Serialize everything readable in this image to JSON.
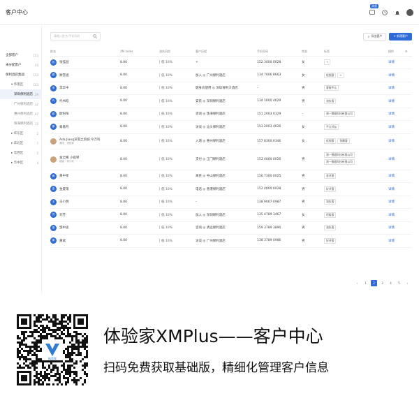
{
  "header": {
    "title": "客户中心",
    "badge": "消息"
  },
  "sidebar": {
    "items": [
      {
        "label": "全部客户",
        "count": "153",
        "level": "top"
      },
      {
        "label": "未分配客户",
        "count": "20",
        "level": "top"
      },
      {
        "label": "保利酒店集团",
        "count": "133",
        "level": "top"
      },
      {
        "label": "华南区",
        "count": "123",
        "level": "child",
        "caret": "▾"
      },
      {
        "label": "深圳保利酒店",
        "count": "29",
        "level": "sub",
        "active": true
      },
      {
        "label": "广州保利酒店",
        "count": "32",
        "level": "sub"
      },
      {
        "label": "惠州保利酒店",
        "count": "47",
        "level": "sub"
      },
      {
        "label": "珠海保利酒店",
        "count": "15",
        "level": "sub"
      },
      {
        "label": "华东区",
        "count": "2",
        "level": "child",
        "caret": "▸"
      },
      {
        "label": "华北区",
        "count": "7",
        "level": "child",
        "caret": "▸"
      },
      {
        "label": "华西区",
        "count": "2",
        "level": "child",
        "caret": "▸"
      },
      {
        "label": "华中区",
        "count": "4",
        "level": "child",
        "caret": "▸"
      }
    ]
  },
  "toolbar": {
    "search_placeholder": "请输入姓名/手机号码",
    "export_label": "导出客户",
    "new_label": "+ 新建客户"
  },
  "table": {
    "headers": [
      "姓名",
      "XM Index",
      "流失风险",
      "客户历程",
      "手机号码",
      "性别",
      "标签",
      "操作"
    ],
    "action_label": "详情",
    "rows": [
      {
        "name": "张桂园",
        "idx": "8.00",
        "risk": "低 10%",
        "journey": "+",
        "phone": "152 3000 0028",
        "gender": "女",
        "tags": [
          "+"
        ]
      },
      {
        "name": "顾雪涵",
        "idx": "8.00",
        "risk": "低 10%",
        "journey": "加入 ◎ 广州保利酒店",
        "phone": "134 7006 8663",
        "gender": "女",
        "tags": [
          "低频客",
          "+"
        ]
      },
      {
        "name": "李华中",
        "idx": "8.00",
        "risk": "低 10%",
        "journey": "健身房使用 ◎ 深圳保利大酒店",
        "phone": "–",
        "gender": "男",
        "tags": [
          "客服不认"
        ]
      },
      {
        "name": "代书晗",
        "idx": "8.00",
        "risk": "低 10%",
        "journey": "安装 ◎ 深圳保利酒店",
        "phone": "134 1000 4029",
        "gender": "男",
        "tags": [
          "流失客"
        ]
      },
      {
        "name": "欧阳阳",
        "idx": "8.00",
        "risk": "低 10%",
        "journey": "咨询 ◎ 珠海保利酒店",
        "phone": "151 2003 0329",
        "gender": "–",
        "tags": [
          "测一数据科技有限公司"
        ]
      },
      {
        "name": "秦嘉月",
        "idx": "8.00",
        "risk": "低 10%",
        "journey": "访谈 ◎ 汕头保利酒店",
        "phone": "153 2003 4026",
        "gender": "女",
        "tags": [
          "不太好友"
        ]
      },
      {
        "name": "Ada Jiang深雪之琅城 今万科",
        "sub": "简阳 · 领航家",
        "idx": "8.00",
        "risk": "低 10%",
        "journey": "入增 ◎ 惠州保利酒店",
        "phone": "157 8300 0346",
        "gender": "女",
        "tags": [
          "低频客",
          "熟腾客"
        ],
        "photo": true
      },
      {
        "name": "金灵晞 小提琴",
        "sub": "超级 · 领小彩",
        "idx": "8.00",
        "risk": "低 10%",
        "journey": "支付 ◎ 江门保利酒店",
        "phone": "153 4000 0026",
        "gender": "男",
        "tags": [
          "测一数据科技有限公司",
          "测一数据科技有限公司"
        ],
        "photo": true,
        "tall": true
      },
      {
        "name": "黄中孝",
        "idx": "8.00",
        "risk": "低 10%",
        "journey": "离开 ◎ 中山保利酒店",
        "phone": "156 7300 0025",
        "gender": "男",
        "tags": [
          "差评客"
        ]
      },
      {
        "name": "金夏雨",
        "idx": "8.00",
        "risk": "低 10%",
        "journey": "电话 ◎ 香港保利酒店",
        "phone": "152 4000 0028",
        "gender": "男",
        "tags": [
          "好评客"
        ]
      },
      {
        "name": "王小明",
        "idx": "8.00",
        "risk": "低 10%",
        "journey": "–",
        "phone": "138 9067 0987",
        "gender": "男",
        "tags": [
          "流失客"
        ]
      },
      {
        "name": "刘芳",
        "idx": "8.00",
        "risk": "低 10%",
        "journey": "加入 ◎ 深圳保利酒店",
        "phone": "135 4789 3467",
        "gender": "女",
        "tags": [
          "积极客"
        ]
      },
      {
        "name": "邹中途",
        "idx": "8.00",
        "risk": "低 10%",
        "journey": "咨询 ◎ 清远保利酒店",
        "phone": "159 3789 3890",
        "gender": "男",
        "tags": [
          "流失客"
        ]
      },
      {
        "name": "黄斌",
        "idx": "8.00",
        "risk": "低 10%",
        "journey": "访谈 ◎ 广州保利酒店",
        "phone": "138 3789 0986",
        "gender": "男",
        "tags": [
          "好评客"
        ]
      }
    ]
  },
  "pagination": {
    "prev": "‹",
    "next": "›",
    "pages": [
      "1",
      "2",
      "3",
      "4",
      "5"
    ],
    "current": "2"
  },
  "promo": {
    "title": "体验家XMPlus——客户中心",
    "subtitle": "扫码免费获取基础版，精细化管理客户信息",
    "qr_logo_text": "体验家"
  }
}
